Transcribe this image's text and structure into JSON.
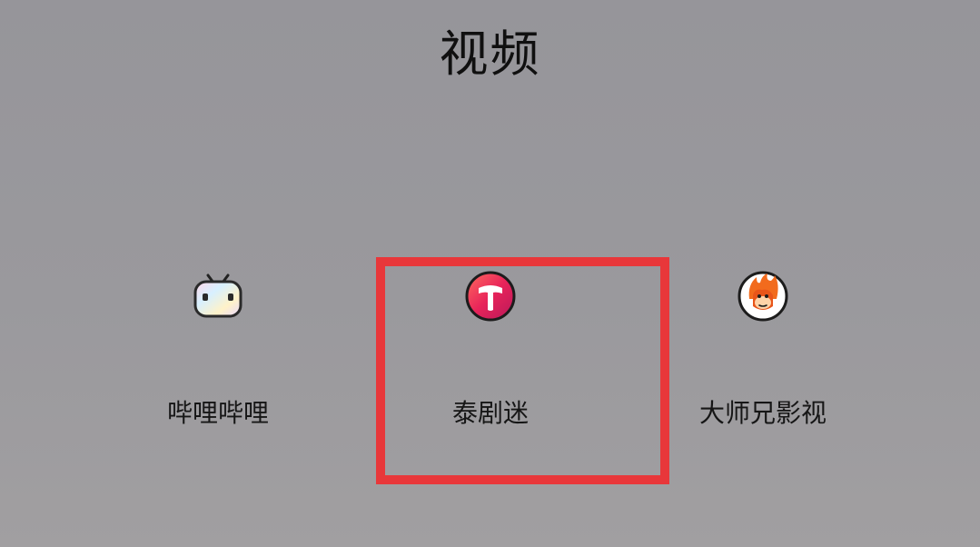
{
  "folder": {
    "title": "视频"
  },
  "apps": [
    {
      "label": "哔哩哔哩",
      "icon": "bilibili-tv-icon"
    },
    {
      "label": "泰剧迷",
      "icon": "taijumi-t-icon"
    },
    {
      "label": "大师兄影视",
      "icon": "dashixiong-monkey-icon"
    }
  ],
  "colors": {
    "highlight": "#e8373a",
    "background": "#98979b"
  }
}
